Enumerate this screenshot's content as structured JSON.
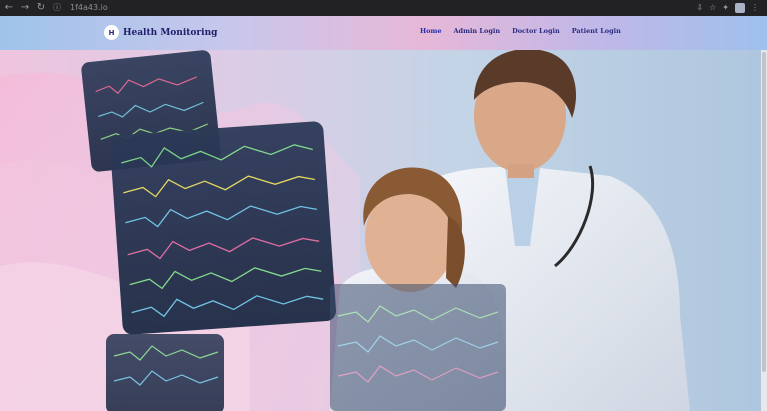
{
  "browser": {
    "url": "1f4a43.io",
    "back_icon": "back-arrow-icon",
    "forward_icon": "forward-arrow-icon",
    "reload_icon": "reload-icon"
  },
  "navbar": {
    "logo_text": "H",
    "brand": "Health Monitoring",
    "items": [
      {
        "label": "Home"
      },
      {
        "label": "Admin Login"
      },
      {
        "label": "Doctor Login"
      },
      {
        "label": "Patient Login"
      }
    ]
  },
  "colors": {
    "nav_active": "#1f2fb0",
    "nav_text": "#2a2a80"
  }
}
